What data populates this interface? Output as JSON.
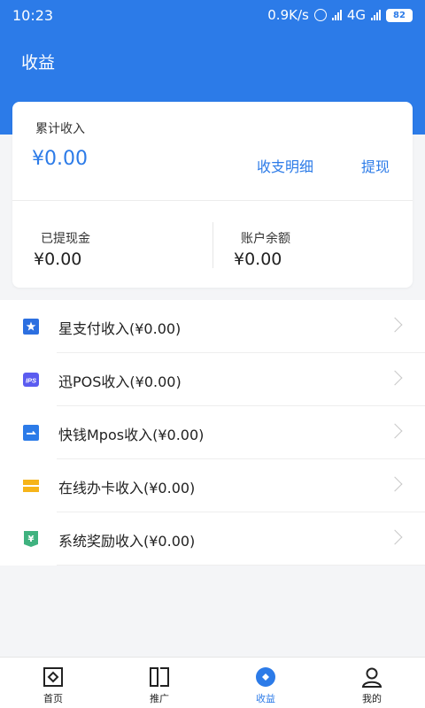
{
  "status_bar": {
    "time": "10:23",
    "net_speed": "0.9K/s",
    "network": "4G",
    "battery": "82"
  },
  "header": {
    "title": "收益"
  },
  "summary": {
    "total_label": "累计收入",
    "total_value": "¥0.00",
    "detail_link": "收支明细",
    "withdraw_link": "提现",
    "withdrawn_label": "已提现金",
    "withdrawn_value": "¥0.00",
    "balance_label": "账户余额",
    "balance_value": "¥0.00"
  },
  "income_items": [
    {
      "label": "星支付收入(¥0.00)",
      "icon": "star-pay-icon",
      "color": "#2c6fe0"
    },
    {
      "label": "迅POS收入(¥0.00)",
      "icon": "ips-icon",
      "color": "#5b5cf0"
    },
    {
      "label": "快钱Mpos收入(¥0.00)",
      "icon": "mpos-icon",
      "color": "#2c7be8"
    },
    {
      "label": "在线办卡收入(¥0.00)",
      "icon": "card-icon",
      "color": "#f6b41a"
    },
    {
      "label": "系统奖励收入(¥0.00)",
      "icon": "reward-icon",
      "color": "#3fb27f"
    }
  ],
  "bottom_nav": [
    {
      "label": "首页",
      "icon": "home-icon"
    },
    {
      "label": "推广",
      "icon": "promote-icon"
    },
    {
      "label": "收益",
      "icon": "earnings-icon",
      "active": true
    },
    {
      "label": "我的",
      "icon": "profile-icon"
    }
  ],
  "colors": {
    "primary": "#2c7be8",
    "background": "#f4f5f7"
  }
}
